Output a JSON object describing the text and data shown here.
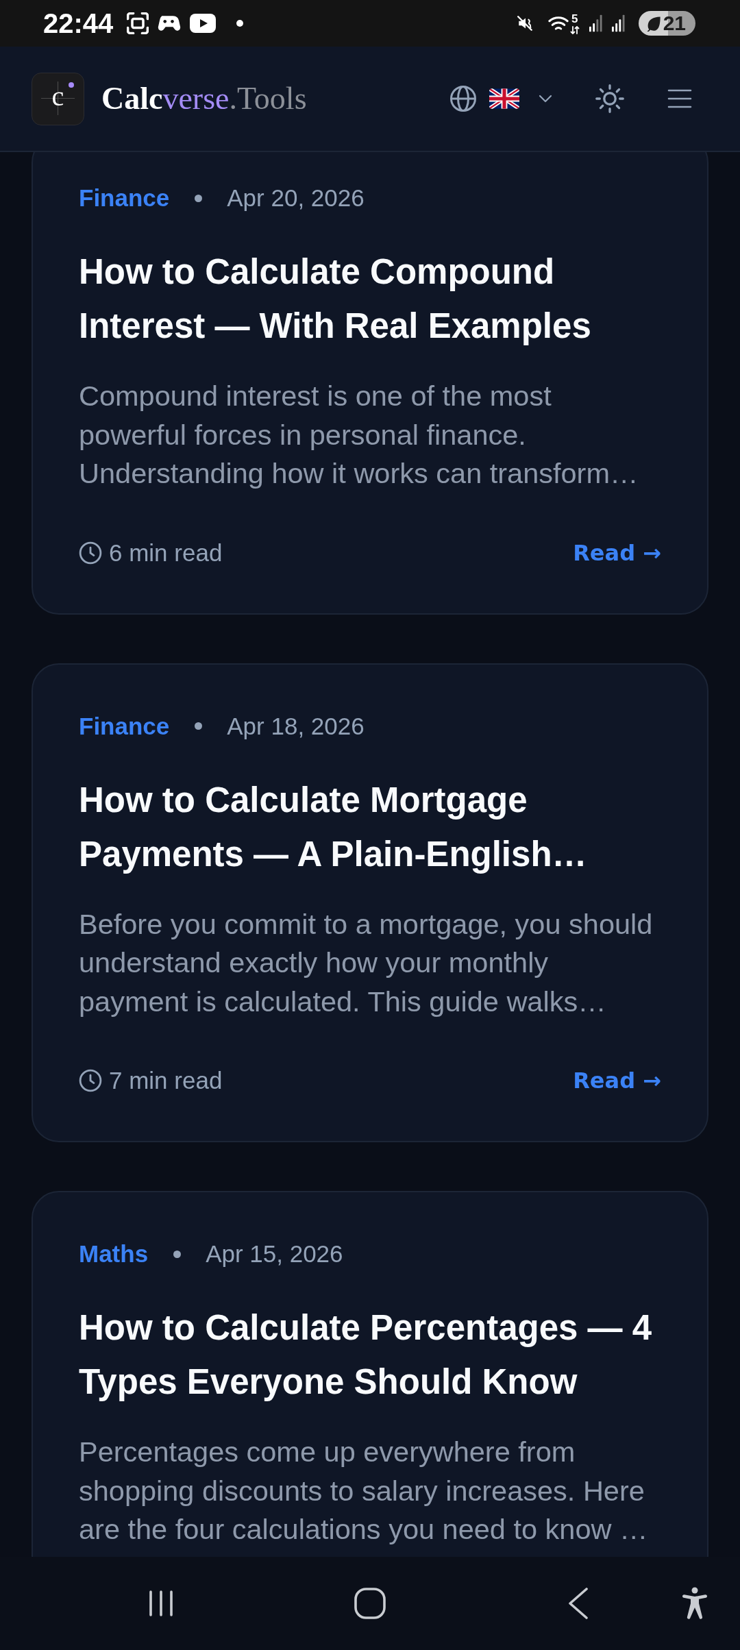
{
  "status_bar": {
    "time": "22:44",
    "network_badge": "5",
    "battery": "21"
  },
  "header": {
    "logo_letter": "c",
    "brand": [
      {
        "text": "Calc",
        "kind": "strong"
      },
      {
        "text": "verse",
        "kind": "accent"
      },
      {
        "text": ".Tools",
        "kind": "muted"
      }
    ]
  },
  "articles": [
    {
      "category": "Finance",
      "date": "Apr 20, 2026",
      "title": "How to Calculate Compound Interest — With Real Examples",
      "excerpt": "Compound interest is one of the most powerful forces in personal finance. Understanding how it works can transform…",
      "read_time": "6 min read",
      "link": "Read →"
    },
    {
      "category": "Finance",
      "date": "Apr 18, 2026",
      "title": "How to Calculate Mortgage Payments — A Plain-English…",
      "excerpt": "Before you commit to a mortgage, you should understand exactly how your monthly payment is calculated. This guide walks…",
      "read_time": "7 min read",
      "link": "Read →"
    },
    {
      "category": "Maths",
      "date": "Apr 15, 2026",
      "title": "How to Calculate Percentages — 4 Types Everyone Should Know",
      "excerpt": "Percentages come up everywhere from shopping discounts to salary increases. Here are the four calculations you need to know …"
    }
  ]
}
